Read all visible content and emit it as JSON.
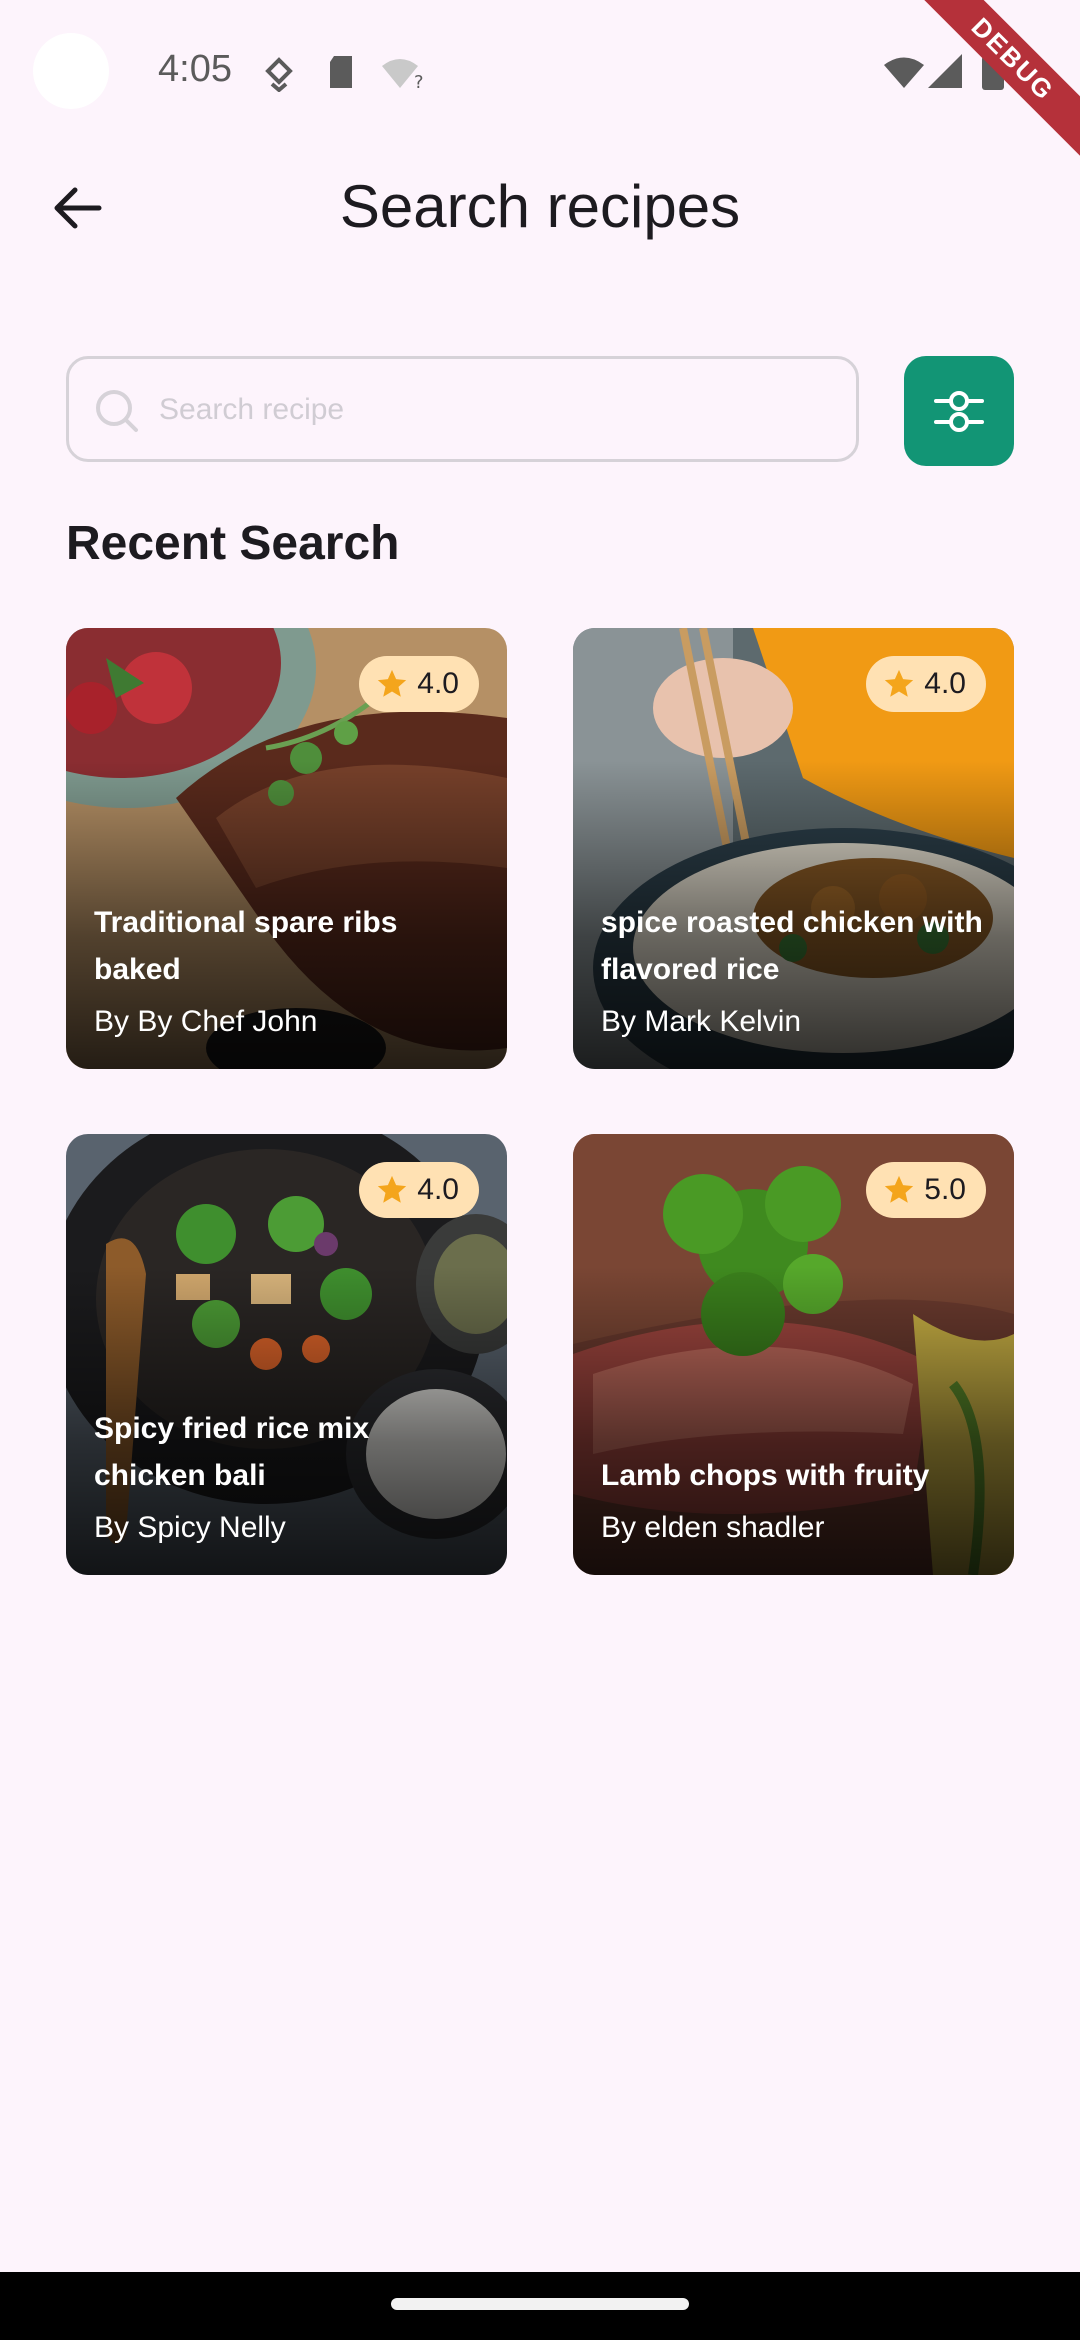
{
  "status_bar": {
    "time": "4:05",
    "debug_label": "DEBUG",
    "icons": [
      "location-icon",
      "sd-card-icon",
      "wifi-question-icon",
      "wifi-icon",
      "signal-icon",
      "battery-icon"
    ]
  },
  "header": {
    "back_icon": "arrow-back-icon",
    "title": "Search recipes"
  },
  "search": {
    "placeholder": "Search recipe",
    "value": "",
    "icon": "search-icon",
    "filter_icon": "filter-sliders-icon"
  },
  "section": {
    "heading": "Recent Search"
  },
  "recipes": [
    {
      "title": "Traditional spare ribs baked",
      "author": "By By Chef John",
      "rating": "4.0",
      "image": "sliced-ribs-photo"
    },
    {
      "title": "spice roasted chicken with flavored rice",
      "author": "By Mark Kelvin",
      "rating": "4.0",
      "image": "chicken-rice-bowl-photo"
    },
    {
      "title": "Spicy fried rice mix chicken bali",
      "author": "By Spicy Nelly",
      "rating": "4.0",
      "image": "stir-fry-pan-photo"
    },
    {
      "title": "Lamb chops with fruity",
      "author": "By elden shadler",
      "rating": "5.0",
      "image": "lamb-chops-parsley-photo"
    }
  ],
  "colors": {
    "background": "#fdf4fc",
    "accent": "#129575",
    "rating_badge": "#ffe1b3",
    "star": "#f4a51c"
  }
}
